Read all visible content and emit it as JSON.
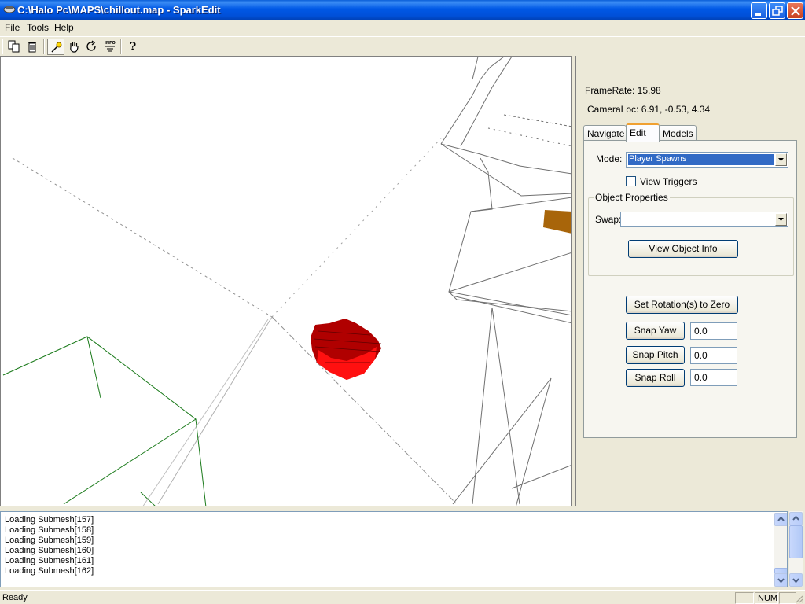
{
  "window": {
    "title": "C:\\Halo Pc\\MAPS\\chillout.map - SparkEdit"
  },
  "menu": {
    "items": [
      "File",
      "Tools",
      "Help"
    ]
  },
  "toolbar": {
    "icons": [
      "copy-icon",
      "delete-icon",
      "select-icon",
      "pan-hand-icon",
      "rotate-icon",
      "info-icon",
      "help-icon"
    ]
  },
  "panel": {
    "framerate_label": "FrameRate: 15.98",
    "camera_label": "CameraLoc: 6.91, -0.53, 4.34",
    "tabs": [
      "Navigate",
      "Edit",
      "Models"
    ],
    "active_tab": "Edit",
    "mode_label": "Mode:",
    "mode_value": "Player Spawns",
    "view_triggers_label": "View Triggers",
    "view_triggers_checked": false,
    "object_properties_title": "Object Properties",
    "swap_label": "Swap:",
    "swap_value": "",
    "view_object_info_button": "View Object Info",
    "set_rotation_button": "Set Rotation(s) to Zero",
    "snap_yaw_button": "Snap Yaw",
    "snap_yaw_value": "0.0",
    "snap_pitch_button": "Snap Pitch",
    "snap_pitch_value": "0.0",
    "snap_roll_button": "Snap Roll",
    "snap_roll_value": "0.0"
  },
  "log": {
    "lines": [
      "Loading Submesh[157]",
      "Loading Submesh[158]",
      "Loading Submesh[159]",
      "Loading Submesh[160]",
      "Loading Submesh[161]",
      "Loading Submesh[162]"
    ]
  },
  "status": {
    "text": "Ready",
    "num": "NUM"
  },
  "colors": {
    "titlebar": "#0058e6",
    "spawn_marker": "#e00000",
    "wireframe": "#808080",
    "green_wire": "#1a7a1a",
    "brown_block": "#a8650a"
  }
}
